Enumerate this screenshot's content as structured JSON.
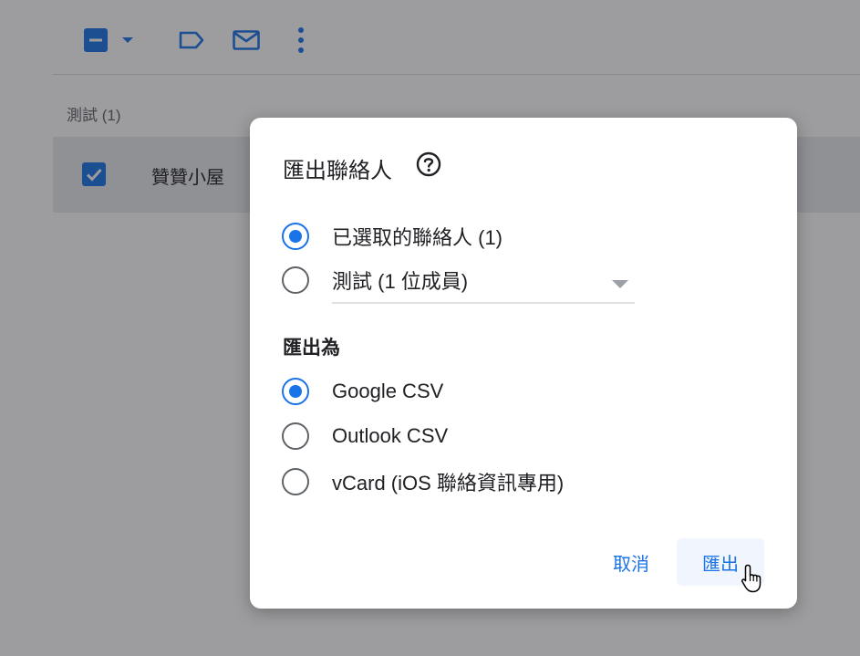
{
  "group": {
    "title": "測試 (1)"
  },
  "contacts": [
    {
      "name": "贊贊小屋",
      "selected": true
    }
  ],
  "dialog": {
    "title": "匯出聯絡人",
    "scope_options": [
      {
        "label": "已選取的聯絡人 (1)",
        "selected": true
      },
      {
        "label": "",
        "selected": false
      }
    ],
    "group_select": {
      "value": "測試 (1 位成員)"
    },
    "format_heading": "匯出為",
    "format_options": [
      {
        "label": "Google CSV",
        "selected": true
      },
      {
        "label": "Outlook CSV",
        "selected": false
      },
      {
        "label": "vCard (iOS 聯絡資訊專用)",
        "selected": false
      }
    ],
    "cancel_label": "取消",
    "export_label": "匯出"
  },
  "colors": {
    "accent": "#1a73e8",
    "radio_off": "#5f6368",
    "row_highlight": "#e8eaed",
    "scrim": "rgba(32,33,36,0.44)"
  },
  "icons": [
    "select-all-checkbox-icon",
    "chevron-down-icon",
    "label-icon",
    "mail-icon",
    "more-vert-icon",
    "checkbox-checked-icon",
    "help-icon",
    "dropdown-caret-icon",
    "hand-pointer-icon"
  ]
}
